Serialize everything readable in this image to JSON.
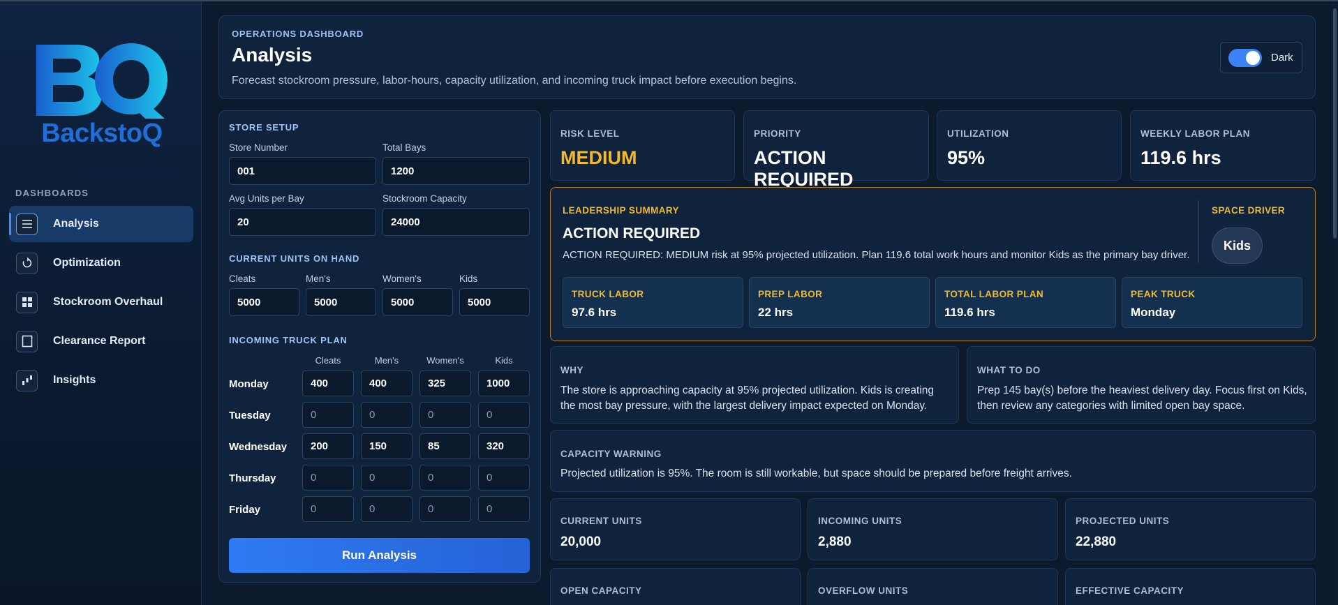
{
  "brand": {
    "name": "BackstoQ",
    "monogram": "BQ"
  },
  "sidebar": {
    "section": "DASHBOARDS",
    "items": [
      {
        "label": "Analysis",
        "icon": "list-icon",
        "active": true
      },
      {
        "label": "Optimization",
        "icon": "refresh-icon",
        "active": false
      },
      {
        "label": "Stockroom Overhaul",
        "icon": "grid-icon",
        "active": false
      },
      {
        "label": "Clearance Report",
        "icon": "square-icon",
        "active": false
      },
      {
        "label": "Insights",
        "icon": "chart-icon",
        "active": false
      }
    ]
  },
  "header": {
    "eyebrow": "OPERATIONS DASHBOARD",
    "title": "Analysis",
    "subtitle": "Forecast stockroom pressure, labor-hours, capacity utilization, and incoming truck impact before execution begins.",
    "theme_toggle": {
      "label": "Dark",
      "on": true
    }
  },
  "setup": {
    "section": "STORE SETUP",
    "store_number": {
      "label": "Store Number",
      "value": "001"
    },
    "total_bays": {
      "label": "Total Bays",
      "value": "1200"
    },
    "avg_units": {
      "label": "Avg Units per Bay",
      "value": "20"
    },
    "capacity": {
      "label": "Stockroom Capacity",
      "value": "24000"
    }
  },
  "on_hand": {
    "section": "CURRENT UNITS ON HAND",
    "fields": [
      {
        "label": "Cleats",
        "value": "5000"
      },
      {
        "label": "Men's",
        "value": "5000"
      },
      {
        "label": "Women's",
        "value": "5000"
      },
      {
        "label": "Kids",
        "value": "5000"
      }
    ]
  },
  "truck_plan": {
    "section": "INCOMING TRUCK PLAN",
    "columns": [
      "Cleats",
      "Men's",
      "Women's",
      "Kids"
    ],
    "rows": [
      {
        "day": "Monday",
        "values": [
          "400",
          "400",
          "325",
          "1000"
        ]
      },
      {
        "day": "Tuesday",
        "values": [
          "0",
          "0",
          "0",
          "0"
        ]
      },
      {
        "day": "Wednesday",
        "values": [
          "200",
          "150",
          "85",
          "320"
        ]
      },
      {
        "day": "Thursday",
        "values": [
          "0",
          "0",
          "0",
          "0"
        ]
      },
      {
        "day": "Friday",
        "values": [
          "0",
          "0",
          "0",
          "0"
        ]
      }
    ],
    "run_label": "Run Analysis"
  },
  "kpis": [
    {
      "label": "RISK LEVEL",
      "value": "MEDIUM"
    },
    {
      "label": "PRIORITY",
      "value": "ACTION REQUIRED"
    },
    {
      "label": "UTILIZATION",
      "value": "95%"
    },
    {
      "label": "WEEKLY LABOR PLAN",
      "value": "119.6 hrs"
    }
  ],
  "summary": {
    "eyebrow": "LEADERSHIP SUMMARY",
    "title": "ACTION REQUIRED",
    "text": "ACTION REQUIRED: MEDIUM risk at 95% projected utilization. Plan 119.6 total work hours and monitor Kids as the primary bay driver.",
    "driver_label": "SPACE DRIVER",
    "driver_value": "Kids",
    "sub": [
      {
        "label": "TRUCK LABOR",
        "value": "97.6 hrs"
      },
      {
        "label": "PREP LABOR",
        "value": "22 hrs"
      },
      {
        "label": "TOTAL LABOR PLAN",
        "value": "119.6 hrs"
      },
      {
        "label": "PEAK TRUCK",
        "value": "Monday"
      }
    ]
  },
  "why": {
    "label": "WHY",
    "text": "The store is approaching capacity at 95% projected utilization. Kids is creating the most bay pressure, with the largest delivery impact expected on Monday."
  },
  "todo": {
    "label": "WHAT TO DO",
    "text": "Prep 145 bay(s) before the heaviest delivery day. Focus first on Kids, then review any categories with limited open bay space."
  },
  "warning": {
    "label": "CAPACITY WARNING",
    "text": "Projected utilization is 95%. The room is still workable, but space should be prepared before freight arrives."
  },
  "units": [
    {
      "label": "CURRENT UNITS",
      "value": "20,000"
    },
    {
      "label": "INCOMING UNITS",
      "value": "2,880"
    },
    {
      "label": "PROJECTED UNITS",
      "value": "22,880"
    },
    {
      "label": "OPEN CAPACITY",
      "value": ""
    },
    {
      "label": "OVERFLOW UNITS",
      "value": ""
    },
    {
      "label": "EFFECTIVE CAPACITY",
      "value": ""
    }
  ],
  "colors": {
    "accent": "#3b82f6",
    "warn": "#f5b82a",
    "bg": "#0c1a2e",
    "card": "#10233c"
  }
}
